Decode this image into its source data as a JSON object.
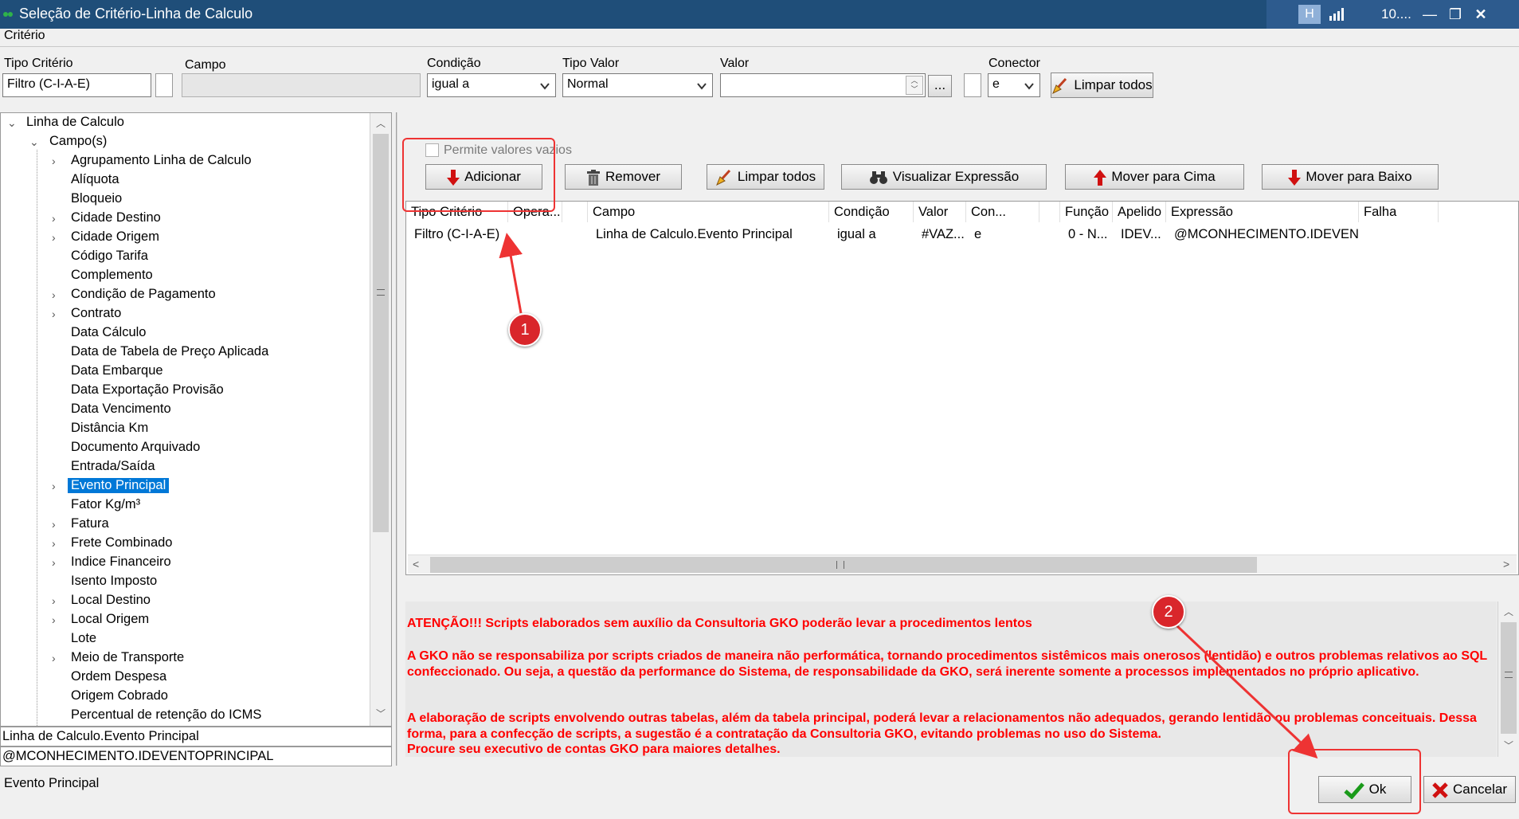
{
  "window": {
    "title": "Seleção de Critério-Linha de Calculo",
    "tray_text": "10...."
  },
  "menu": {
    "criterio": "Critério"
  },
  "filters": {
    "tipo_criterio_label": "Tipo Critério",
    "tipo_criterio_value": "Filtro (C-I-A-E)",
    "campo_label": "Campo",
    "campo_value": "",
    "condicao_label": "Condição",
    "condicao_value": "igual a",
    "tipo_valor_label": "Tipo Valor",
    "tipo_valor_value": "Normal",
    "valor_label": "Valor",
    "valor_value": "",
    "valor_dots": "...",
    "conector_label": "Conector",
    "conector_value": "e",
    "limpar_todos_label": "Limpar todos"
  },
  "tree": {
    "root": "Linha de Calculo",
    "campos": "Campo(s)",
    "items": [
      "Agrupamento Linha de Calculo",
      "Alíquota",
      "Bloqueio",
      "Cidade Destino",
      "Cidade Origem",
      "Código Tarifa",
      "Complemento",
      "Condição de Pagamento",
      "Contrato",
      "Data Cálculo",
      "Data de Tabela de Preço Aplicada",
      "Data Embarque",
      "Data Exportação Provisão",
      "Data Vencimento",
      "Distância Km",
      "Documento Arquivado",
      "Entrada/Saída",
      "Evento Principal",
      "Fator Kg/m³",
      "Fatura",
      "Frete Combinado",
      "Indice Financeiro",
      "Isento Imposto",
      "Local Destino",
      "Local Origem",
      "Lote",
      "Meio de Transporte",
      "Ordem Despesa",
      "Origem Cobrado",
      "Percentual de retenção do ICMS"
    ],
    "path_text": "Linha de Calculo.Evento Principal",
    "expr_text": "@MCONHECIMENTO.IDEVENTOPRINCIPAL",
    "selected_desc": "Evento Principal"
  },
  "actions": {
    "permite_label": "Permite valores vazios",
    "adicionar": "Adicionar",
    "remover": "Remover",
    "limpar_todos": "Limpar todos",
    "visualizar": "Visualizar Expressão",
    "mover_cima": "Mover para Cima",
    "mover_baixo": "Mover para Baixo"
  },
  "grid": {
    "headers": [
      "Tipo Critério",
      "Opera...",
      "",
      "Campo",
      "Condição",
      "Valor",
      "Con...",
      "",
      "Função",
      "Apelido",
      "Expressão",
      "Falha"
    ],
    "row": [
      "Filtro (C-I-A-E)",
      "",
      "",
      "Linha de Calculo.Evento Principal",
      "igual a",
      "#VAZ...",
      "e",
      "",
      "0 - N...",
      "IDEV...",
      "@MCONHECIMENTO.IDEVENTOPRINCIPAL =",
      ""
    ]
  },
  "warnings": {
    "w1": "ATENÇÃO!!! Scripts elaborados sem auxílio da Consultoria GKO poderão levar a procedimentos lentos",
    "w2": "A GKO não se responsabiliza por scripts criados de maneira não performática, tornando procedimentos sistêmicos mais onerosos (lentidão) e outros problemas relativos ao SQL confeccionado. Ou seja, a questão da performance do Sistema, de responsabilidade da GKO, será inerente somente a processos implementados no próprio aplicativo.",
    "w3": "A elaboração de scripts envolvendo outras tabelas, além da tabela principal, poderá levar a relacionamentos não adequados, gerando lentidão ou problemas conceituais. Dessa forma, para a confecção de scripts, a sugestão é a contratação da Consultoria GKO, evitando problemas no uso do Sistema.",
    "w4": "Procure seu executivo de contas GKO para maiores detalhes."
  },
  "footer": {
    "ok": "Ok",
    "cancelar": "Cancelar"
  },
  "annotations": {
    "badge1": "1",
    "badge2": "2"
  },
  "colors": {
    "titlebar": "#1f4e79",
    "selection": "#0078d7",
    "warning": "#ff0000",
    "annotation": "#d9262b"
  }
}
